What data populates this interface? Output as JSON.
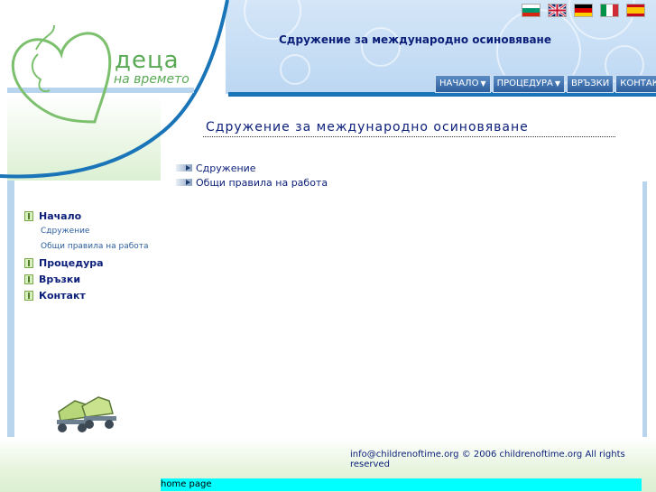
{
  "header": {
    "logo_line1": "деца",
    "logo_line2": "на времето",
    "site_title": "Сдружение за международно осиновяване"
  },
  "flags": [
    "bulgarian-flag",
    "english-flag",
    "german-flag",
    "italian-flag",
    "spanish-flag"
  ],
  "topnav": {
    "home": "НАЧАЛО",
    "procedure": "ПРОЦЕДУРА",
    "links": "ВРЪЗКИ",
    "contact": "КОНТАКТ"
  },
  "main": {
    "heading": "Сдружение за международно осиновяване",
    "links": [
      "Сдружение",
      "Общи правила на работа"
    ]
  },
  "sidebar": {
    "items": [
      {
        "label": "Начало",
        "subitems": [
          "Сдружение",
          "Общи правила на работа"
        ]
      },
      {
        "label": "Процедура"
      },
      {
        "label": "Връзки"
      },
      {
        "label": "Контакт"
      }
    ]
  },
  "footer": {
    "email": "info@childrenoftime.org",
    "copyright": "© 2006 childrenoftime.org All rights reserved"
  },
  "status_bar": "home page",
  "colors": {
    "title_blue": "#0b1f7a",
    "logo_green": "#5aaa55",
    "header_blue": "#bcd7f2",
    "status_cyan": "#00ffff"
  }
}
